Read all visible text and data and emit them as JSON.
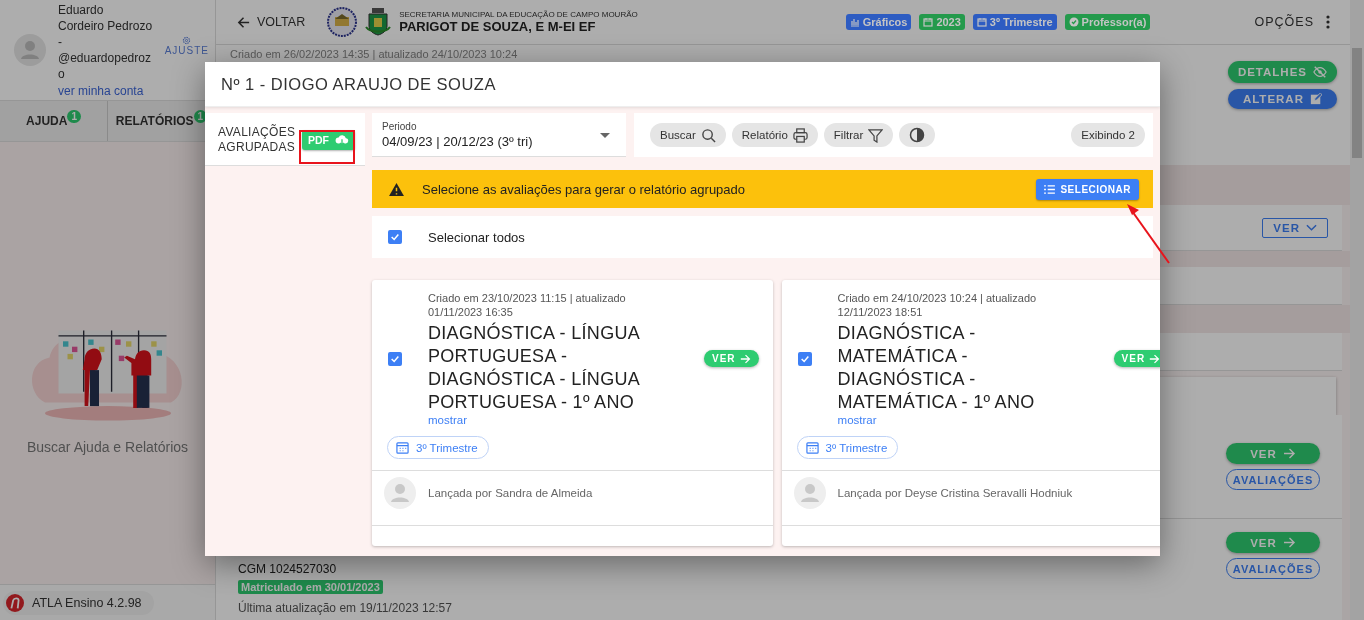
{
  "sidebar": {
    "user": {
      "name": "Eduardo Cordeiro Pedrozo - @eduardopedrozo",
      "settings_label": "AJUSTE",
      "account_link": "ver minha conta"
    },
    "tabs": [
      {
        "label": "AJUDA",
        "badge": "1",
        "selected": false
      },
      {
        "label": "RELATÓRIOS",
        "badge": "1",
        "selected": false
      }
    ],
    "empty_message": "Buscar Ajuda e Relatórios",
    "version": "ATLA Ensino 4.2.98"
  },
  "header": {
    "back": "VOLTAR",
    "org": "SECRETARIA MUNICIPAL DA EDUCAÇÃO DE CAMPO MOURÃO",
    "school": "PARIGOT DE SOUZA, E M-EI EF",
    "tags": [
      {
        "kind": "chart",
        "label": "Gráficos",
        "color": "#2d5cc2"
      },
      {
        "kind": "calendar",
        "label": "2023",
        "color": "#249a4c"
      },
      {
        "kind": "calendar",
        "label": "3º Trimestre",
        "color": "#2d5cc2"
      },
      {
        "kind": "check",
        "label": "Professor(a)",
        "color": "#249a4c"
      }
    ],
    "menu": "OPÇÕES"
  },
  "background": {
    "meta": "Criado em 26/02/2023 14:35 | atualizado 24/10/2023 10:24",
    "details_button": "DETALHES",
    "edit_button": "ALTERAR",
    "expand_button": "VER",
    "rows": [
      {
        "view": "VER",
        "evaluations": "AVALIAÇÕES"
      },
      {
        "view": "VER",
        "evaluations": "AVALIAÇÕES"
      }
    ],
    "student": {
      "cgm": "CGM 1024527030",
      "status": "Matriculado em 30/01/2023",
      "updated": "Última atualização em 19/11/2023 12:57"
    }
  },
  "modal": {
    "title": "Nº 1 - DIOGO ARAUJO DE SOUZA",
    "group_label": "AVALIAÇÕES AGRUPADAS",
    "pdf_button": "PDF",
    "period": {
      "label": "Periodo",
      "value": "04/09/23 | 20/12/23 (3º tri)"
    },
    "toolbar": [
      {
        "kind": "search",
        "label": "Buscar"
      },
      {
        "kind": "print",
        "label": "Relatório"
      },
      {
        "kind": "filter",
        "label": "Filtrar"
      },
      {
        "kind": "contrast"
      }
    ],
    "count": "Exibindo 2",
    "alert": {
      "message": "Selecione as avaliações para gerar o relatório agrupado",
      "button": "SELECIONAR"
    },
    "select_all": {
      "label": "Selecionar todos",
      "checked": true
    },
    "cards": [
      {
        "meta": "Criado em 23/10/2023 11:15 | atualizado 01/11/2023 16:35",
        "title": "DIAGNÓSTICA - LÍNGUA PORTUGUESA - DIAGNÓSTICA - LÍNGUA PORTUGUESA - 1º ANO",
        "more": "mostrar",
        "view": "VER",
        "period": "3º Trimestre",
        "author": "Lançada por Sandra de Almeida",
        "checked": true
      },
      {
        "meta": "Criado em 24/10/2023 10:24 | atualizado 12/11/2023 18:51",
        "title": "DIAGNÓSTICA - MATEMÁTICA - DIAGNÓSTICA - MATEMÁTICA - 1º ANO",
        "more": "mostrar",
        "view": "VER",
        "period": "3º Trimestre",
        "author": "Lançada por Deyse Cristina Seravalli Hodniuk",
        "checked": true
      }
    ]
  }
}
